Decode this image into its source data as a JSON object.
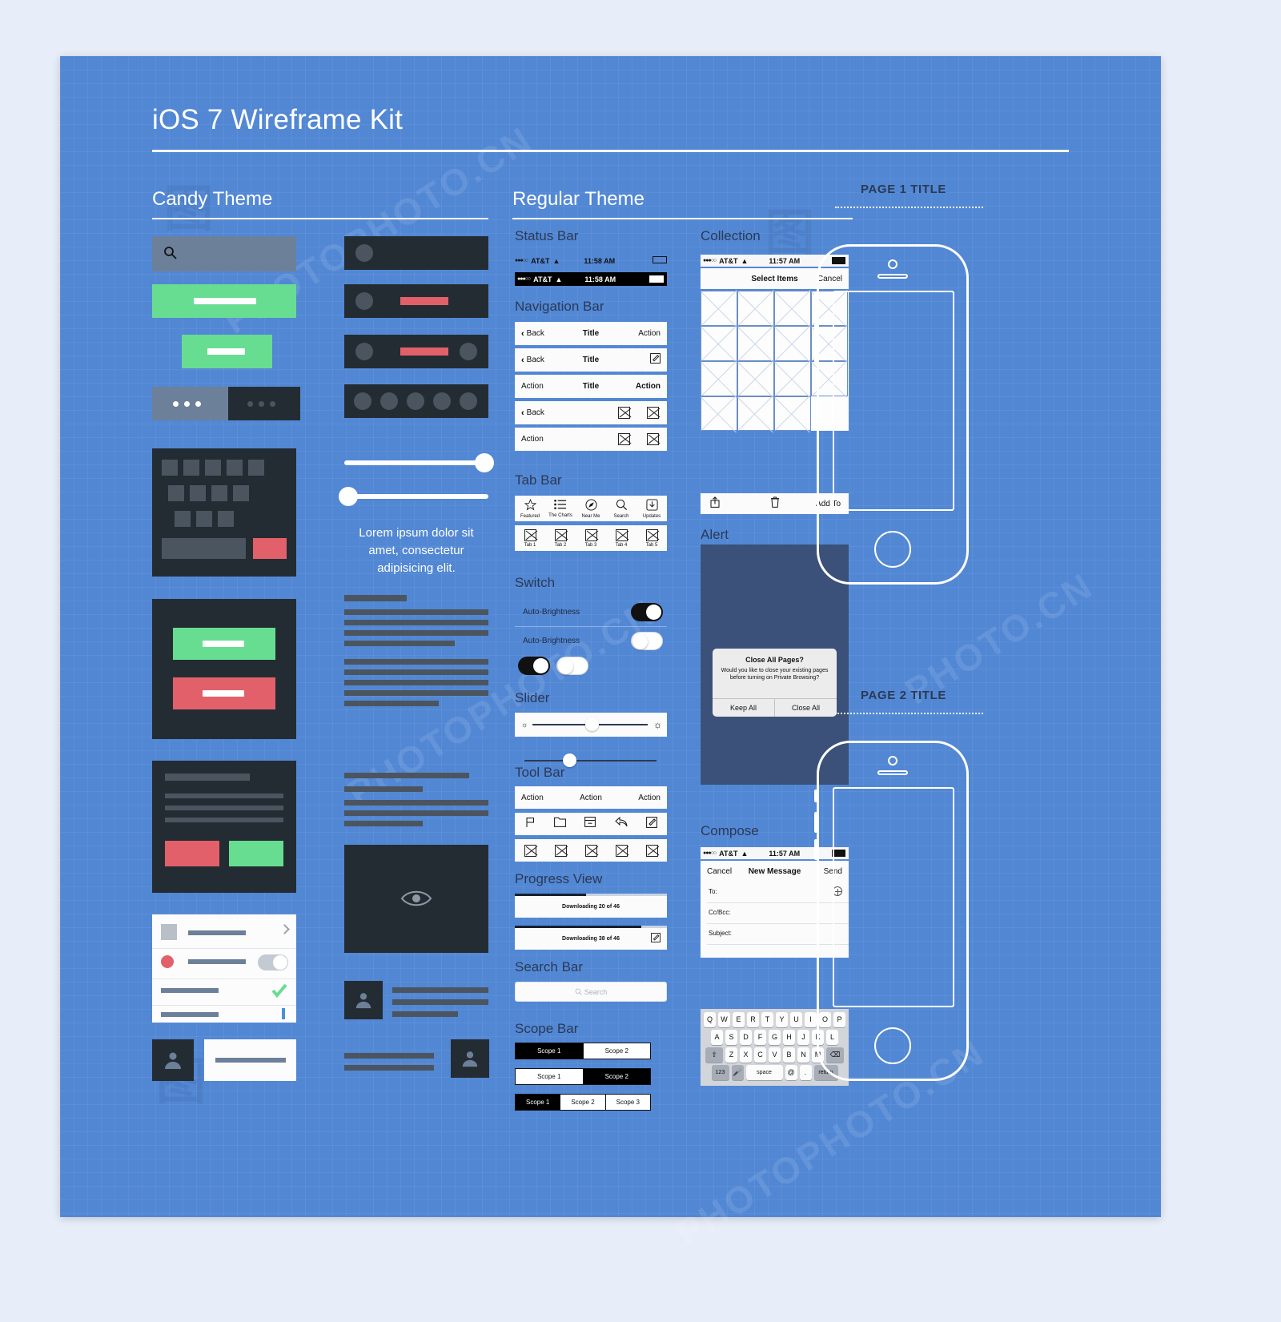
{
  "kit": {
    "title": "iOS 7 Wireframe Kit"
  },
  "sections": {
    "candy": "Candy Theme",
    "regular": "Regular Theme",
    "status_bar": "Status Bar",
    "navigation_bar": "Navigation Bar",
    "tab_bar": "Tab Bar",
    "switch": "Switch",
    "slider": "Slider",
    "tool_bar": "Tool Bar",
    "progress_view": "Progress View",
    "search_bar": "Search Bar",
    "scope_bar": "Scope Bar",
    "collection": "Collection",
    "alert": "Alert",
    "compose": "Compose"
  },
  "status_bar": {
    "carrier": "AT&T",
    "time": "11:58 AM",
    "dots": "●●●○○"
  },
  "navigation_bars": [
    {
      "left": "Back",
      "title": "Title",
      "right": "Action",
      "back_chevron": true
    },
    {
      "left": "Back",
      "title": "Title",
      "right": "icon-compose",
      "back_chevron": true
    },
    {
      "left": "Action",
      "title": "Title",
      "right": "Action",
      "back_chevron": false
    },
    {
      "left": "Back",
      "title": "",
      "right": "icon-x-x",
      "back_chevron": true
    },
    {
      "left": "Action",
      "title": "",
      "right": "icon-x-x",
      "back_chevron": false
    }
  ],
  "tab_bar": {
    "labeled": [
      {
        "label": "Featured",
        "icon": "star-icon"
      },
      {
        "label": "The Charts",
        "icon": "list-icon"
      },
      {
        "label": "Near Me",
        "icon": "compass-icon"
      },
      {
        "label": "Search",
        "icon": "search-icon"
      },
      {
        "label": "Updates",
        "icon": "download-icon"
      }
    ],
    "generic": [
      {
        "label": "Tab 1",
        "icon": "placeholder-icon"
      },
      {
        "label": "Tab 2",
        "icon": "placeholder-icon"
      },
      {
        "label": "Tab 3",
        "icon": "placeholder-icon"
      },
      {
        "label": "Tab 4",
        "icon": "placeholder-icon"
      },
      {
        "label": "Tab 5",
        "icon": "placeholder-icon"
      }
    ]
  },
  "switches": [
    {
      "label": "Auto-Brightness",
      "state": "on"
    },
    {
      "label": "Auto-Brightness",
      "state": "off"
    }
  ],
  "tool_bar": {
    "actions": [
      "Action",
      "Action",
      "Action"
    ],
    "icons": [
      "flag-icon",
      "folder-icon",
      "archive-icon",
      "reply-icon",
      "compose-icon"
    ],
    "placeholders": [
      "placeholder-icon",
      "placeholder-icon",
      "placeholder-icon",
      "placeholder-icon",
      "placeholder-icon"
    ]
  },
  "progress": [
    {
      "label": "Downloading 20 of 46",
      "percent": 47
    },
    {
      "label": "Downloading 38 of 46",
      "percent": 83
    }
  ],
  "search_bar": {
    "placeholder": "Search",
    "icon": "search-icon"
  },
  "scope_bars": [
    {
      "items": [
        "Scope 1",
        "Scope 2"
      ],
      "selected": 0
    },
    {
      "items": [
        "Scope 1",
        "Scope 2"
      ],
      "selected": 1
    },
    {
      "items": [
        "Scope 1",
        "Scope 2",
        "Scope 3"
      ],
      "selected": 0
    }
  ],
  "collection": {
    "status": {
      "carrier": "AT&T",
      "time": "11:57 AM"
    },
    "title": "Select Items",
    "cancel": "Cancel",
    "toolbar": {
      "share": "share-icon",
      "trash": "trash-icon",
      "add_to": "Add To"
    }
  },
  "alert": {
    "title": "Close All Pages?",
    "message": "Would you like to close your existing pages before turning on Private Browsing?",
    "buttons": [
      "Keep All",
      "Close All"
    ]
  },
  "compose": {
    "status": {
      "carrier": "AT&T",
      "time": "11:57 AM"
    },
    "cancel": "Cancel",
    "title": "New Message",
    "send": "Send",
    "fields": [
      {
        "label": "To:",
        "accessory": "add-contact-icon"
      },
      {
        "label": "Cc/Bcc:",
        "accessory": ""
      },
      {
        "label": "Subject:",
        "accessory": ""
      }
    ]
  },
  "keyboard": {
    "row1": [
      "Q",
      "W",
      "E",
      "R",
      "T",
      "Y",
      "U",
      "I",
      "O",
      "P"
    ],
    "row2": [
      "A",
      "S",
      "D",
      "F",
      "G",
      "H",
      "J",
      "K",
      "L"
    ],
    "row3": [
      "⇧",
      "Z",
      "X",
      "C",
      "V",
      "B",
      "N",
      "M",
      "⌫"
    ],
    "row4": [
      "123",
      "Ἲ4",
      "space",
      "@",
      ".",
      "return"
    ]
  },
  "lorem": "Lorem ipsum dolor sit amet, consectetur adipisicing elit.",
  "pages": [
    {
      "title": "PAGE 1 TITLE"
    },
    {
      "title": "PAGE 2 TITLE"
    }
  ],
  "colors": {
    "canvas": "#5287d4",
    "dark": "#242c33",
    "green": "#67dd91",
    "red": "#e2606a",
    "grey": "#6d8099",
    "white": "#ffffff",
    "alert_overlay": "#3b5179"
  }
}
